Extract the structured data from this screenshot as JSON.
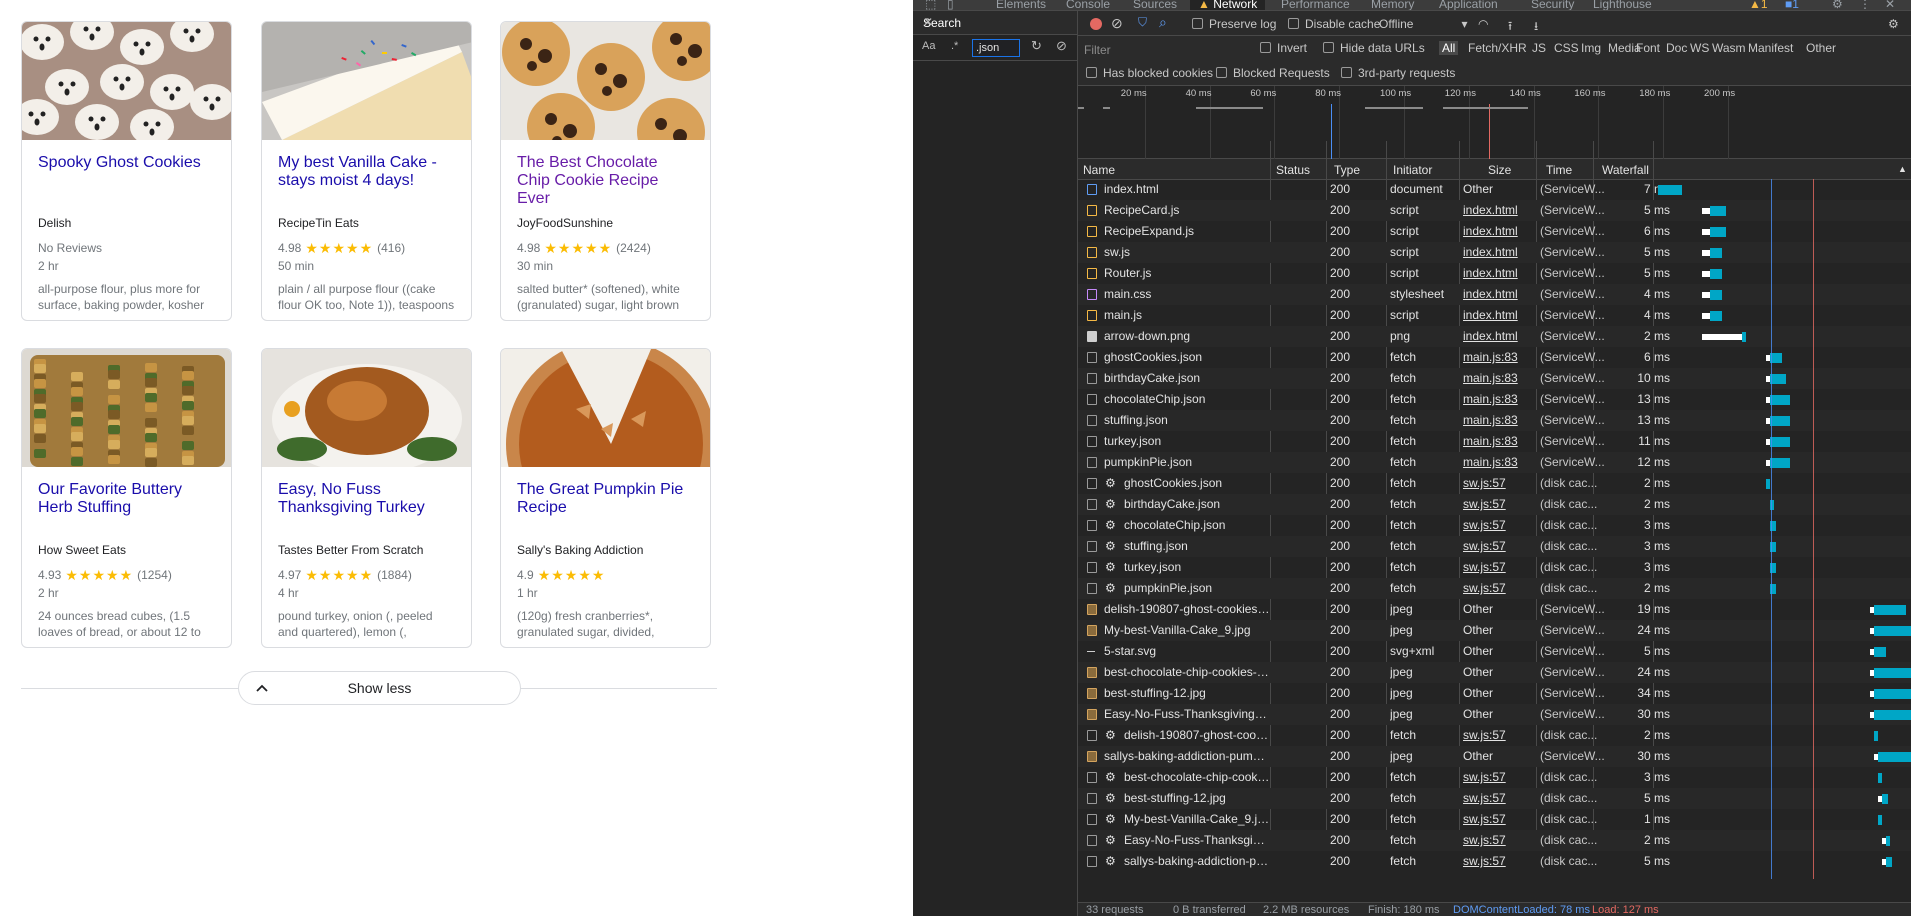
{
  "recipes": [
    {
      "title": "Spooky Ghost Cookies",
      "source": "Delish",
      "rating": "",
      "reviews": "No Reviews",
      "time": "2 hr",
      "ingredients": "all-purpose flour, plus more for surface, baking powder, kosher",
      "visited": false,
      "image": "ghost-cookies"
    },
    {
      "title": "My best Vanilla Cake - stays moist 4 days!",
      "source": "RecipeTin Eats",
      "rating": "4.98",
      "reviews": "(416)",
      "time": "50 min",
      "ingredients": "plain / all purpose flour ((cake flour OK too, Note 1)), teaspoons",
      "visited": false,
      "image": "vanilla-cake"
    },
    {
      "title": "The Best Chocolate Chip Cookie Recipe Ever",
      "source": "JoyFoodSunshine",
      "rating": "4.98",
      "reviews": "(2424)",
      "time": "30 min",
      "ingredients": "salted butter* (softened), white (granulated) sugar, light brown",
      "visited": true,
      "image": "chocolate-chip-cookies"
    },
    {
      "title": "Our Favorite Buttery Herb Stuffing",
      "source": "How Sweet Eats",
      "rating": "4.93",
      "reviews": "(1254)",
      "time": "2 hr",
      "ingredients": "24 ounces bread cubes, (1.5 loaves of bread, or about 12 to",
      "visited": false,
      "image": "herb-stuffing"
    },
    {
      "title": "Easy, No Fuss Thanksgiving Turkey",
      "source": "Tastes Better From Scratch",
      "rating": "4.97",
      "reviews": "(1884)",
      "time": "4 hr",
      "ingredients": "pound turkey, onion (, peeled and quartered), lemon (, quartered),",
      "visited": false,
      "image": "roast-turkey"
    },
    {
      "title": "The Great Pumpkin Pie Recipe",
      "source": "Sally's Baking Addiction",
      "rating": "4.9",
      "reviews": "",
      "time": "1 hr",
      "ingredients": "(120g) fresh cranberries*, granulated sugar, divided,",
      "visited": false,
      "image": "pumpkin-pie"
    }
  ],
  "show_less_label": "Show less",
  "stars_glyph": "★★★★★",
  "devtools": {
    "tabs": [
      "Elements",
      "Console",
      "Sources",
      "Network",
      "Performance",
      "Memory",
      "Application",
      "Security",
      "Lighthouse"
    ],
    "active_tab": "Network",
    "warnings_count": "1",
    "messages_count": "1",
    "search": {
      "title": "Search",
      "query": ".json",
      "case_label": "Aa",
      "regex_label": ".*"
    },
    "toolbar": {
      "preserve_log": "Preserve log",
      "disable_cache": "Disable cache",
      "throttle": "Offline"
    },
    "filter": {
      "placeholder": "Filter",
      "invert": "Invert",
      "hide_data_urls": "Hide data URLs",
      "types": [
        "All",
        "Fetch/XHR",
        "JS",
        "CSS",
        "Img",
        "Media",
        "Font",
        "Doc",
        "WS",
        "Wasm",
        "Manifest",
        "Other"
      ],
      "active_type": "All",
      "has_blocked_cookies": "Has blocked cookies",
      "blocked_requests": "Blocked Requests",
      "third_party": "3rd-party requests"
    },
    "overview_ticks": [
      "20 ms",
      "40 ms",
      "60 ms",
      "80 ms",
      "100 ms",
      "120 ms",
      "140 ms",
      "160 ms",
      "180 ms",
      "200 ms"
    ],
    "columns": {
      "name": "Name",
      "status": "Status",
      "type": "Type",
      "initiator": "Initiator",
      "size": "Size",
      "time": "Time",
      "waterfall": "Waterfall"
    },
    "requests": [
      {
        "name": "index.html",
        "status": "200",
        "type": "document",
        "initiator": "Other",
        "size": "(ServiceW...",
        "time": "7 ms",
        "icon": "doc",
        "gear": false,
        "link": false,
        "wf_start": 0,
        "wf_wait": 0,
        "wf_recv": 6
      },
      {
        "name": "RecipeCard.js",
        "status": "200",
        "type": "script",
        "initiator": "index.html",
        "size": "(ServiceW...",
        "time": "5 ms",
        "icon": "script",
        "gear": false,
        "link": true,
        "wf_start": 11,
        "wf_wait": 2,
        "wf_recv": 4
      },
      {
        "name": "RecipeExpand.js",
        "status": "200",
        "type": "script",
        "initiator": "index.html",
        "size": "(ServiceW...",
        "time": "6 ms",
        "icon": "script",
        "gear": false,
        "link": true,
        "wf_start": 11,
        "wf_wait": 2,
        "wf_recv": 4
      },
      {
        "name": "sw.js",
        "status": "200",
        "type": "script",
        "initiator": "index.html",
        "size": "(ServiceW...",
        "time": "5 ms",
        "icon": "script",
        "gear": false,
        "link": true,
        "wf_start": 11,
        "wf_wait": 2,
        "wf_recv": 3
      },
      {
        "name": "Router.js",
        "status": "200",
        "type": "script",
        "initiator": "index.html",
        "size": "(ServiceW...",
        "time": "5 ms",
        "icon": "script",
        "gear": false,
        "link": true,
        "wf_start": 11,
        "wf_wait": 2,
        "wf_recv": 3
      },
      {
        "name": "main.css",
        "status": "200",
        "type": "stylesheet",
        "initiator": "index.html",
        "size": "(ServiceW...",
        "time": "4 ms",
        "icon": "css",
        "gear": false,
        "link": true,
        "wf_start": 11,
        "wf_wait": 2,
        "wf_recv": 3
      },
      {
        "name": "main.js",
        "status": "200",
        "type": "script",
        "initiator": "index.html",
        "size": "(ServiceW...",
        "time": "4 ms",
        "icon": "script",
        "gear": false,
        "link": true,
        "wf_start": 11,
        "wf_wait": 2,
        "wf_recv": 3
      },
      {
        "name": "arrow-down.png",
        "status": "200",
        "type": "png",
        "initiator": "index.html",
        "size": "(ServiceW...",
        "time": "2 ms",
        "icon": "img",
        "gear": false,
        "link": true,
        "wf_start": 11,
        "wf_wait": 10,
        "wf_recv": 1
      },
      {
        "name": "ghostCookies.json",
        "status": "200",
        "type": "fetch",
        "initiator": "main.js:83",
        "size": "(ServiceW...",
        "time": "6 ms",
        "icon": "fetch",
        "gear": false,
        "link": true,
        "wf_start": 27,
        "wf_wait": 1,
        "wf_recv": 3
      },
      {
        "name": "birthdayCake.json",
        "status": "200",
        "type": "fetch",
        "initiator": "main.js:83",
        "size": "(ServiceW...",
        "time": "10 ms",
        "icon": "fetch",
        "gear": false,
        "link": true,
        "wf_start": 27,
        "wf_wait": 1,
        "wf_recv": 4
      },
      {
        "name": "chocolateChip.json",
        "status": "200",
        "type": "fetch",
        "initiator": "main.js:83",
        "size": "(ServiceW...",
        "time": "13 ms",
        "icon": "fetch",
        "gear": false,
        "link": true,
        "wf_start": 27,
        "wf_wait": 1,
        "wf_recv": 5
      },
      {
        "name": "stuffing.json",
        "status": "200",
        "type": "fetch",
        "initiator": "main.js:83",
        "size": "(ServiceW...",
        "time": "13 ms",
        "icon": "fetch",
        "gear": false,
        "link": true,
        "wf_start": 27,
        "wf_wait": 1,
        "wf_recv": 5
      },
      {
        "name": "turkey.json",
        "status": "200",
        "type": "fetch",
        "initiator": "main.js:83",
        "size": "(ServiceW...",
        "time": "11 ms",
        "icon": "fetch",
        "gear": false,
        "link": true,
        "wf_start": 27,
        "wf_wait": 1,
        "wf_recv": 5
      },
      {
        "name": "pumpkinPie.json",
        "status": "200",
        "type": "fetch",
        "initiator": "main.js:83",
        "size": "(ServiceW...",
        "time": "12 ms",
        "icon": "fetch",
        "gear": false,
        "link": true,
        "wf_start": 27,
        "wf_wait": 1,
        "wf_recv": 5
      },
      {
        "name": "ghostCookies.json",
        "status": "200",
        "type": "fetch",
        "initiator": "sw.js:57",
        "size": "(disk cac...",
        "time": "2 ms",
        "icon": "fetch",
        "gear": true,
        "link": true,
        "wf_start": 27,
        "wf_wait": 0,
        "wf_recv": 1
      },
      {
        "name": "birthdayCake.json",
        "status": "200",
        "type": "fetch",
        "initiator": "sw.js:57",
        "size": "(disk cac...",
        "time": "2 ms",
        "icon": "fetch",
        "gear": true,
        "link": true,
        "wf_start": 28,
        "wf_wait": 0,
        "wf_recv": 1
      },
      {
        "name": "chocolateChip.json",
        "status": "200",
        "type": "fetch",
        "initiator": "sw.js:57",
        "size": "(disk cac...",
        "time": "3 ms",
        "icon": "fetch",
        "gear": true,
        "link": true,
        "wf_start": 28,
        "wf_wait": 0,
        "wf_recv": 1.5
      },
      {
        "name": "stuffing.json",
        "status": "200",
        "type": "fetch",
        "initiator": "sw.js:57",
        "size": "(disk cac...",
        "time": "3 ms",
        "icon": "fetch",
        "gear": true,
        "link": true,
        "wf_start": 28,
        "wf_wait": 0,
        "wf_recv": 1.5
      },
      {
        "name": "turkey.json",
        "status": "200",
        "type": "fetch",
        "initiator": "sw.js:57",
        "size": "(disk cac...",
        "time": "3 ms",
        "icon": "fetch",
        "gear": true,
        "link": true,
        "wf_start": 28,
        "wf_wait": 0,
        "wf_recv": 1.5
      },
      {
        "name": "pumpkinPie.json",
        "status": "200",
        "type": "fetch",
        "initiator": "sw.js:57",
        "size": "(disk cac...",
        "time": "2 ms",
        "icon": "fetch",
        "gear": true,
        "link": true,
        "wf_start": 28,
        "wf_wait": 0,
        "wf_recv": 1.5
      },
      {
        "name": "delish-190807-ghost-cookies-0031-l...",
        "status": "200",
        "type": "jpeg",
        "initiator": "Other",
        "size": "(ServiceW...",
        "time": "19 ms",
        "icon": "imgc",
        "gear": false,
        "link": false,
        "wf_start": 53,
        "wf_wait": 1,
        "wf_recv": 8
      },
      {
        "name": "My-best-Vanilla-Cake_9.jpg",
        "status": "200",
        "type": "jpeg",
        "initiator": "Other",
        "size": "(ServiceW...",
        "time": "24 ms",
        "icon": "imgc",
        "gear": false,
        "link": false,
        "wf_start": 53,
        "wf_wait": 1,
        "wf_recv": 10
      },
      {
        "name": "5-star.svg",
        "status": "200",
        "type": "svg+xml",
        "initiator": "Other",
        "size": "(ServiceW...",
        "time": "5 ms",
        "icon": "svg",
        "gear": false,
        "link": false,
        "wf_start": 53,
        "wf_wait": 1,
        "wf_recv": 3
      },
      {
        "name": "best-chocolate-chip-cookies-recipe-...",
        "status": "200",
        "type": "jpeg",
        "initiator": "Other",
        "size": "(ServiceW...",
        "time": "24 ms",
        "icon": "imgc",
        "gear": false,
        "link": false,
        "wf_start": 53,
        "wf_wait": 1,
        "wf_recv": 10
      },
      {
        "name": "best-stuffing-12.jpg",
        "status": "200",
        "type": "jpeg",
        "initiator": "Other",
        "size": "(ServiceW...",
        "time": "34 ms",
        "icon": "imgc",
        "gear": false,
        "link": false,
        "wf_start": 53,
        "wf_wait": 1,
        "wf_recv": 12
      },
      {
        "name": "Easy-No-Fuss-Thanksgiving-Turkey-...",
        "status": "200",
        "type": "jpeg",
        "initiator": "Other",
        "size": "(ServiceW...",
        "time": "30 ms",
        "icon": "imgc",
        "gear": false,
        "link": false,
        "wf_start": 53,
        "wf_wait": 1,
        "wf_recv": 12
      },
      {
        "name": "delish-190807-ghost-cookies-00...",
        "status": "200",
        "type": "fetch",
        "initiator": "sw.js:57",
        "size": "(disk cac...",
        "time": "2 ms",
        "icon": "fetch",
        "gear": true,
        "link": true,
        "wf_start": 54,
        "wf_wait": 0,
        "wf_recv": 1
      },
      {
        "name": "sallys-baking-addiction-pumpkin-pi...",
        "status": "200",
        "type": "jpeg",
        "initiator": "Other",
        "size": "(ServiceW...",
        "time": "30 ms",
        "icon": "imgc",
        "gear": false,
        "link": false,
        "wf_start": 54,
        "wf_wait": 1,
        "wf_recv": 11
      },
      {
        "name": "best-chocolate-chip-cookies-reci...",
        "status": "200",
        "type": "fetch",
        "initiator": "sw.js:57",
        "size": "(disk cac...",
        "time": "3 ms",
        "icon": "fetch",
        "gear": true,
        "link": true,
        "wf_start": 55,
        "wf_wait": 0,
        "wf_recv": 1
      },
      {
        "name": "best-stuffing-12.jpg",
        "status": "200",
        "type": "fetch",
        "initiator": "sw.js:57",
        "size": "(disk cac...",
        "time": "5 ms",
        "icon": "fetch",
        "gear": true,
        "link": true,
        "wf_start": 55,
        "wf_wait": 1,
        "wf_recv": 1.5
      },
      {
        "name": "My-best-Vanilla-Cake_9.jpg",
        "status": "200",
        "type": "fetch",
        "initiator": "sw.js:57",
        "size": "(disk cac...",
        "time": "1 ms",
        "icon": "fetch",
        "gear": true,
        "link": true,
        "wf_start": 55,
        "wf_wait": 0,
        "wf_recv": 1
      },
      {
        "name": "Easy-No-Fuss-Thanksgiving-Turk...",
        "status": "200",
        "type": "fetch",
        "initiator": "sw.js:57",
        "size": "(disk cac...",
        "time": "2 ms",
        "icon": "fetch",
        "gear": true,
        "link": true,
        "wf_start": 56,
        "wf_wait": 1,
        "wf_recv": 1
      },
      {
        "name": "sallys-baking-addiction-pumpkin...",
        "status": "200",
        "type": "fetch",
        "initiator": "sw.js:57",
        "size": "(disk cac...",
        "time": "5 ms",
        "icon": "fetch",
        "gear": true,
        "link": true,
        "wf_start": 56,
        "wf_wait": 1,
        "wf_recv": 1.5
      }
    ],
    "statusbar": {
      "requests": "33 requests",
      "transferred": "0 B transferred",
      "resources": "2.2 MB resources",
      "finish": "Finish: 180 ms",
      "dom_content_loaded": "DOMContentLoaded: 78 ms",
      "load": "Load: 127 ms"
    },
    "colors": {
      "dcl_line": "#4a8ff7",
      "load_line": "#e46962",
      "waterfall_bar": "#00a6c6",
      "accent": "#1a73e8"
    }
  }
}
